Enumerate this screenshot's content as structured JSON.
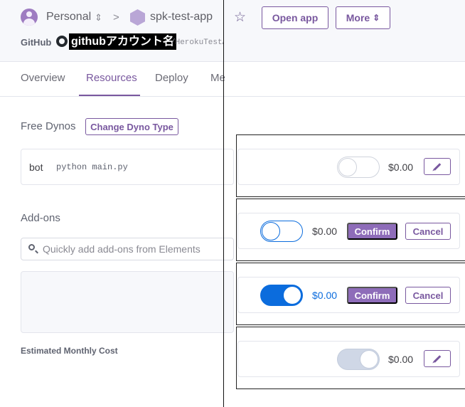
{
  "header": {
    "account": "Personal",
    "app_name": "spk-test-app",
    "star_glyph": "☆",
    "open_app_label": "Open app",
    "more_label": "More",
    "switcher_glyph": "⇕",
    "chevron_glyph": ">",
    "github_label": "GitHub",
    "github_account": "githubアカウント名",
    "repo_path": "/HerokuTestApp"
  },
  "tabs": [
    {
      "label": "Overview"
    },
    {
      "label": "Resources",
      "active": true
    },
    {
      "label": "Deploy"
    },
    {
      "label": "Me"
    }
  ],
  "dynos": {
    "section_label": "Free Dynos",
    "change_type_label": "Change Dyno Type",
    "process_name": "bot",
    "command": "python main.py"
  },
  "addons": {
    "section_label": "Add-ons",
    "search_placeholder": "Quickly add add-ons from Elements",
    "estimated_cost_label": "Estimated Monthly Cost"
  },
  "states": [
    {
      "toggle": "off",
      "price": "$0.00",
      "actions": [
        "edit"
      ]
    },
    {
      "toggle": "off-focused",
      "price": "$0.00",
      "actions": [
        "confirm",
        "cancel"
      ]
    },
    {
      "toggle": "on",
      "price": "$0.00",
      "actions": [
        "confirm",
        "cancel"
      ]
    },
    {
      "toggle": "disabled-on",
      "price": "$0.00",
      "actions": [
        "edit"
      ]
    }
  ],
  "confirm_label": "Confirm",
  "cancel_label": "Cancel",
  "colors": {
    "accent": "#79589f",
    "toggle_on": "#0b6cdd",
    "toggle_disabled": "#cfd7e6"
  }
}
